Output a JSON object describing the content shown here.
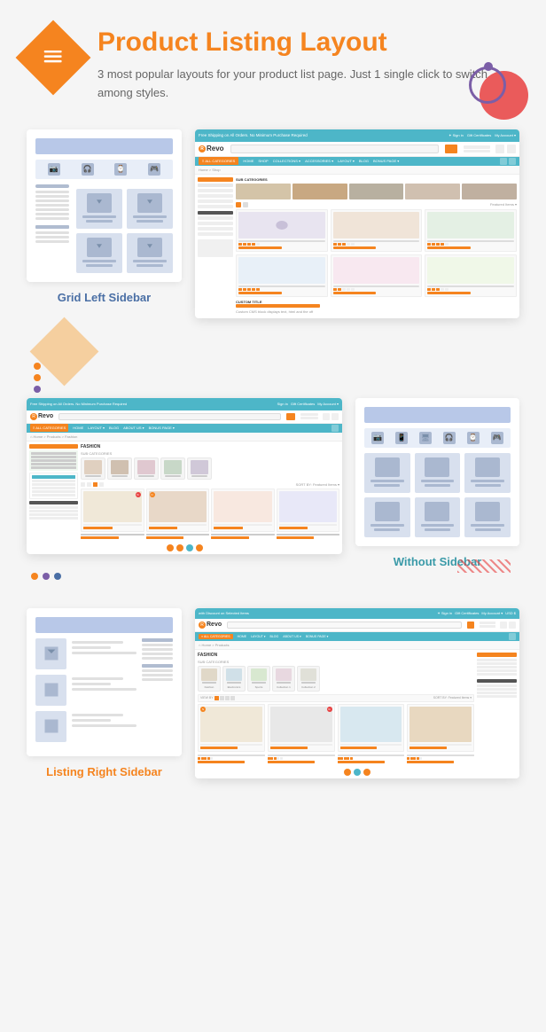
{
  "header": {
    "title": "Product Listing Layout",
    "description": "3 most popular layouts for your product list page. Just 1 single click to switch among styles.",
    "icon": "≡"
  },
  "sections": [
    {
      "id": "grid-left-sidebar",
      "label": "Grid Left Sidebar",
      "label_color": "label-blue"
    },
    {
      "id": "without-sidebar",
      "label": "Without Sidebar",
      "label_color": "label-teal"
    },
    {
      "id": "listing-right-sidebar",
      "label": "Listing Right Sidebar",
      "label_color": "label-orange"
    }
  ],
  "revo": {
    "brand": "Revo",
    "free_shipping": "Free Shipping on All Orders. No Minimum Purchase Required",
    "nav_items": [
      "HOME",
      "SHOP",
      "COLLECTIONS",
      "ACCESSORIES",
      "LAYOUT",
      "BLOG",
      "BONUS PAGE"
    ],
    "all_categories": "ALL CATEGORIES",
    "sub_categories": "SUB CATEGORIES",
    "shop_by_price": "SHOP BY PRICE",
    "custom_cms": "CUSTOM CMS BLOCK",
    "custom_title": "CUSTOM TITLE",
    "fashion": "FASHION"
  },
  "colors": {
    "orange": "#f5841f",
    "teal": "#4db6c8",
    "purple": "#7b5ea7",
    "blue": "#4a6fa5",
    "light_blue_wf": "#d8e0ee",
    "header_wf": "#b8c8e8"
  }
}
